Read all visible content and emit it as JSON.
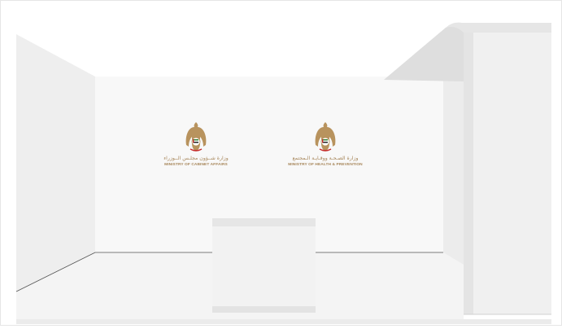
{
  "logos": [
    {
      "arabic": "وزارة شــؤون مجلـس الــوزراء",
      "english": "MINISTRY OF CABINET AFFAIRS"
    },
    {
      "arabic": "وزارة الصـحـة ووقـايـة الـمجتمع",
      "english": "MINISTRY OF HEALTH & PREVENTION"
    }
  ],
  "colors": {
    "logo_gold": "#a7865a",
    "wall_back": "#f7f7f7",
    "wall_side": "#efefef",
    "floor": "#f5f5f5",
    "outline": "#8c8c8c"
  }
}
